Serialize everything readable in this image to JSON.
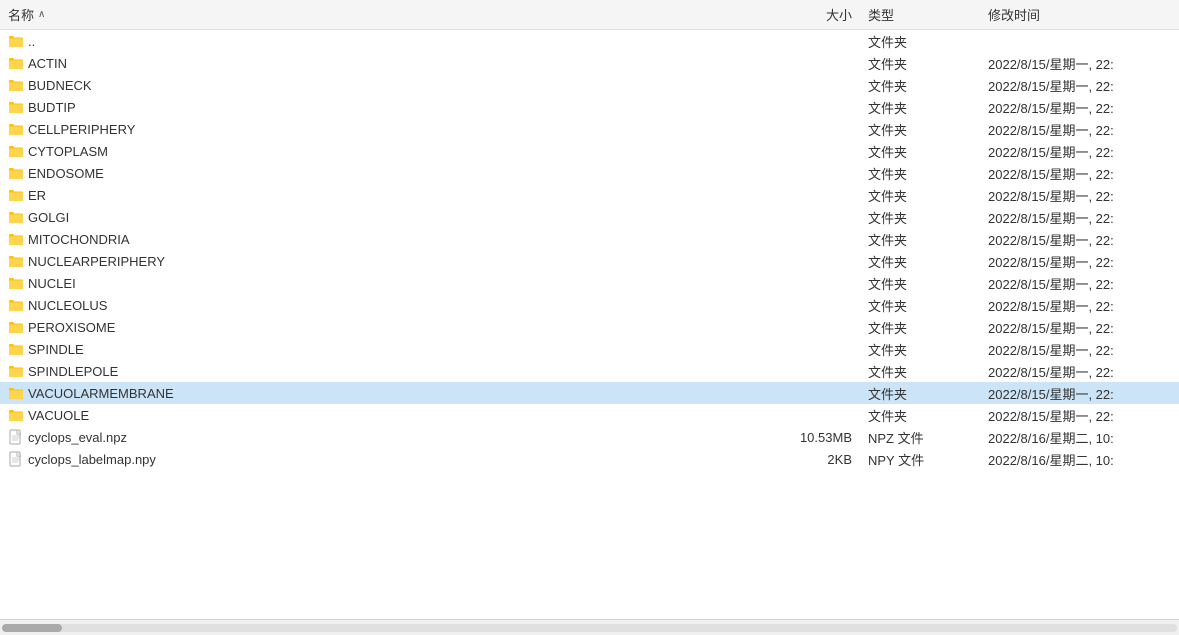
{
  "header": {
    "col_name": "名称",
    "col_size": "大小",
    "col_type": "类型",
    "col_modified": "修改时间",
    "sort_arrow": "∧"
  },
  "folders": [
    {
      "name": "..",
      "type": "文件夹",
      "modified": ""
    },
    {
      "name": "ACTIN",
      "type": "文件夹",
      "modified": "2022/8/15/星期一, 22:"
    },
    {
      "name": "BUDNECK",
      "type": "文件夹",
      "modified": "2022/8/15/星期一, 22:"
    },
    {
      "name": "BUDTIP",
      "type": "文件夹",
      "modified": "2022/8/15/星期一, 22:"
    },
    {
      "name": "CELLPERIPHERY",
      "type": "文件夹",
      "modified": "2022/8/15/星期一, 22:"
    },
    {
      "name": "CYTOPLASM",
      "type": "文件夹",
      "modified": "2022/8/15/星期一, 22:"
    },
    {
      "name": "ENDOSOME",
      "type": "文件夹",
      "modified": "2022/8/15/星期一, 22:"
    },
    {
      "name": "ER",
      "type": "文件夹",
      "modified": "2022/8/15/星期一, 22:"
    },
    {
      "name": "GOLGI",
      "type": "文件夹",
      "modified": "2022/8/15/星期一, 22:"
    },
    {
      "name": "MITOCHONDRIA",
      "type": "文件夹",
      "modified": "2022/8/15/星期一, 22:"
    },
    {
      "name": "NUCLEARPERIPHERY",
      "type": "文件夹",
      "modified": "2022/8/15/星期一, 22:"
    },
    {
      "name": "NUCLEI",
      "type": "文件夹",
      "modified": "2022/8/15/星期一, 22:"
    },
    {
      "name": "NUCLEOLUS",
      "type": "文件夹",
      "modified": "2022/8/15/星期一, 22:"
    },
    {
      "name": "PEROXISOME",
      "type": "文件夹",
      "modified": "2022/8/15/星期一, 22:"
    },
    {
      "name": "SPINDLE",
      "type": "文件夹",
      "modified": "2022/8/15/星期一, 22:"
    },
    {
      "name": "SPINDLEPOLE",
      "type": "文件夹",
      "modified": "2022/8/15/星期一, 22:"
    },
    {
      "name": "VACUOLARMEMBRANE",
      "type": "文件夹",
      "modified": "2022/8/15/星期一, 22:",
      "selected": true
    },
    {
      "name": "VACUOLE",
      "type": "文件夹",
      "modified": "2022/8/15/星期一, 22:"
    }
  ],
  "files": [
    {
      "name": "cyclops_eval.npz",
      "size": "10.53MB",
      "type": "NPZ 文件",
      "modified": "2022/8/16/星期二, 10:"
    },
    {
      "name": "cyclops_labelmap.npy",
      "size": "2KB",
      "type": "NPY 文件",
      "modified": "2022/8/16/星期二, 10:"
    }
  ]
}
